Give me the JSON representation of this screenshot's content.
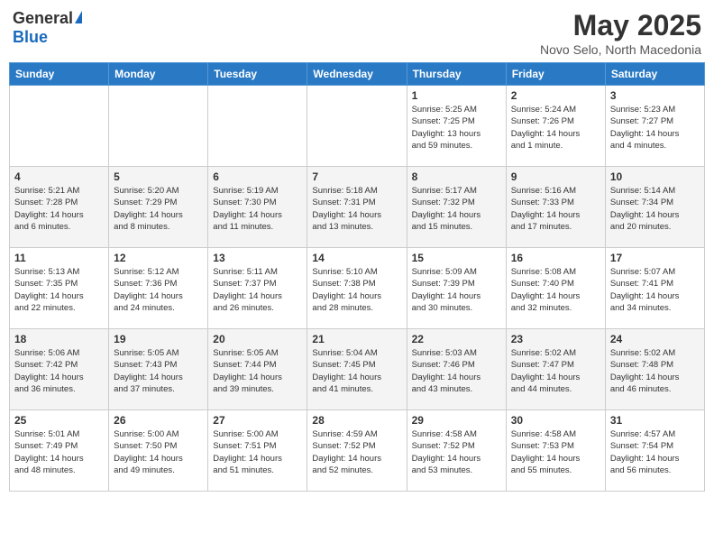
{
  "header": {
    "logo_general": "General",
    "logo_blue": "Blue",
    "month_title": "May 2025",
    "subtitle": "Novo Selo, North Macedonia"
  },
  "weekdays": [
    "Sunday",
    "Monday",
    "Tuesday",
    "Wednesday",
    "Thursday",
    "Friday",
    "Saturday"
  ],
  "weeks": [
    [
      {
        "day": "",
        "info": ""
      },
      {
        "day": "",
        "info": ""
      },
      {
        "day": "",
        "info": ""
      },
      {
        "day": "",
        "info": ""
      },
      {
        "day": "1",
        "info": "Sunrise: 5:25 AM\nSunset: 7:25 PM\nDaylight: 13 hours\nand 59 minutes."
      },
      {
        "day": "2",
        "info": "Sunrise: 5:24 AM\nSunset: 7:26 PM\nDaylight: 14 hours\nand 1 minute."
      },
      {
        "day": "3",
        "info": "Sunrise: 5:23 AM\nSunset: 7:27 PM\nDaylight: 14 hours\nand 4 minutes."
      }
    ],
    [
      {
        "day": "4",
        "info": "Sunrise: 5:21 AM\nSunset: 7:28 PM\nDaylight: 14 hours\nand 6 minutes."
      },
      {
        "day": "5",
        "info": "Sunrise: 5:20 AM\nSunset: 7:29 PM\nDaylight: 14 hours\nand 8 minutes."
      },
      {
        "day": "6",
        "info": "Sunrise: 5:19 AM\nSunset: 7:30 PM\nDaylight: 14 hours\nand 11 minutes."
      },
      {
        "day": "7",
        "info": "Sunrise: 5:18 AM\nSunset: 7:31 PM\nDaylight: 14 hours\nand 13 minutes."
      },
      {
        "day": "8",
        "info": "Sunrise: 5:17 AM\nSunset: 7:32 PM\nDaylight: 14 hours\nand 15 minutes."
      },
      {
        "day": "9",
        "info": "Sunrise: 5:16 AM\nSunset: 7:33 PM\nDaylight: 14 hours\nand 17 minutes."
      },
      {
        "day": "10",
        "info": "Sunrise: 5:14 AM\nSunset: 7:34 PM\nDaylight: 14 hours\nand 20 minutes."
      }
    ],
    [
      {
        "day": "11",
        "info": "Sunrise: 5:13 AM\nSunset: 7:35 PM\nDaylight: 14 hours\nand 22 minutes."
      },
      {
        "day": "12",
        "info": "Sunrise: 5:12 AM\nSunset: 7:36 PM\nDaylight: 14 hours\nand 24 minutes."
      },
      {
        "day": "13",
        "info": "Sunrise: 5:11 AM\nSunset: 7:37 PM\nDaylight: 14 hours\nand 26 minutes."
      },
      {
        "day": "14",
        "info": "Sunrise: 5:10 AM\nSunset: 7:38 PM\nDaylight: 14 hours\nand 28 minutes."
      },
      {
        "day": "15",
        "info": "Sunrise: 5:09 AM\nSunset: 7:39 PM\nDaylight: 14 hours\nand 30 minutes."
      },
      {
        "day": "16",
        "info": "Sunrise: 5:08 AM\nSunset: 7:40 PM\nDaylight: 14 hours\nand 32 minutes."
      },
      {
        "day": "17",
        "info": "Sunrise: 5:07 AM\nSunset: 7:41 PM\nDaylight: 14 hours\nand 34 minutes."
      }
    ],
    [
      {
        "day": "18",
        "info": "Sunrise: 5:06 AM\nSunset: 7:42 PM\nDaylight: 14 hours\nand 36 minutes."
      },
      {
        "day": "19",
        "info": "Sunrise: 5:05 AM\nSunset: 7:43 PM\nDaylight: 14 hours\nand 37 minutes."
      },
      {
        "day": "20",
        "info": "Sunrise: 5:05 AM\nSunset: 7:44 PM\nDaylight: 14 hours\nand 39 minutes."
      },
      {
        "day": "21",
        "info": "Sunrise: 5:04 AM\nSunset: 7:45 PM\nDaylight: 14 hours\nand 41 minutes."
      },
      {
        "day": "22",
        "info": "Sunrise: 5:03 AM\nSunset: 7:46 PM\nDaylight: 14 hours\nand 43 minutes."
      },
      {
        "day": "23",
        "info": "Sunrise: 5:02 AM\nSunset: 7:47 PM\nDaylight: 14 hours\nand 44 minutes."
      },
      {
        "day": "24",
        "info": "Sunrise: 5:02 AM\nSunset: 7:48 PM\nDaylight: 14 hours\nand 46 minutes."
      }
    ],
    [
      {
        "day": "25",
        "info": "Sunrise: 5:01 AM\nSunset: 7:49 PM\nDaylight: 14 hours\nand 48 minutes."
      },
      {
        "day": "26",
        "info": "Sunrise: 5:00 AM\nSunset: 7:50 PM\nDaylight: 14 hours\nand 49 minutes."
      },
      {
        "day": "27",
        "info": "Sunrise: 5:00 AM\nSunset: 7:51 PM\nDaylight: 14 hours\nand 51 minutes."
      },
      {
        "day": "28",
        "info": "Sunrise: 4:59 AM\nSunset: 7:52 PM\nDaylight: 14 hours\nand 52 minutes."
      },
      {
        "day": "29",
        "info": "Sunrise: 4:58 AM\nSunset: 7:52 PM\nDaylight: 14 hours\nand 53 minutes."
      },
      {
        "day": "30",
        "info": "Sunrise: 4:58 AM\nSunset: 7:53 PM\nDaylight: 14 hours\nand 55 minutes."
      },
      {
        "day": "31",
        "info": "Sunrise: 4:57 AM\nSunset: 7:54 PM\nDaylight: 14 hours\nand 56 minutes."
      }
    ]
  ]
}
